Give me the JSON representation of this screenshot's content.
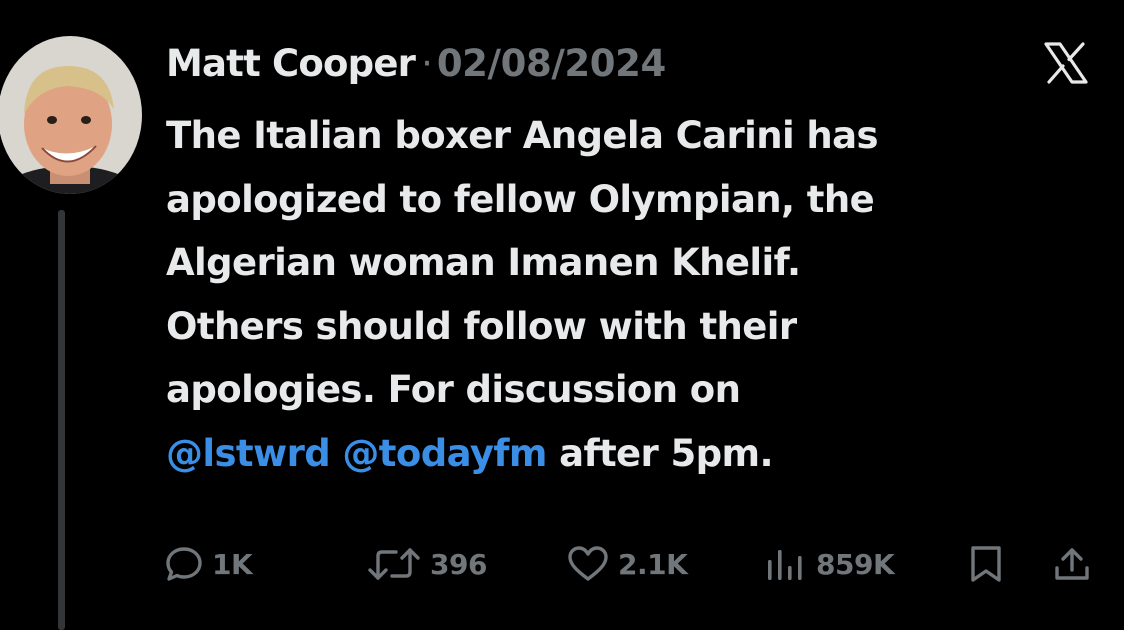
{
  "tweet": {
    "author_name": "Matt Cooper",
    "separator": "·",
    "date": "02/08/2024",
    "body_lines": [
      "The Italian boxer Angela Carini has",
      "apologized to fellow Olympian, the",
      "Algerian woman Imanen Khelif.",
      "Others should follow with their",
      "apologies. For discussion on"
    ],
    "mentions": [
      "@lstwrd",
      "@todayfm"
    ],
    "after_mentions": "after 5pm."
  },
  "actions": {
    "replies": {
      "icon": "reply-icon",
      "count": "1K"
    },
    "reposts": {
      "icon": "repost-icon",
      "count": "396"
    },
    "likes": {
      "icon": "like-icon",
      "count": "2.1K"
    },
    "views": {
      "icon": "views-icon",
      "count": "859K"
    },
    "bookmark": {
      "icon": "bookmark-icon"
    },
    "share": {
      "icon": "share-icon"
    }
  },
  "colors": {
    "background": "#000000",
    "text": "#e7e9ea",
    "secondary": "#71767b",
    "link": "#3a8ee6"
  }
}
